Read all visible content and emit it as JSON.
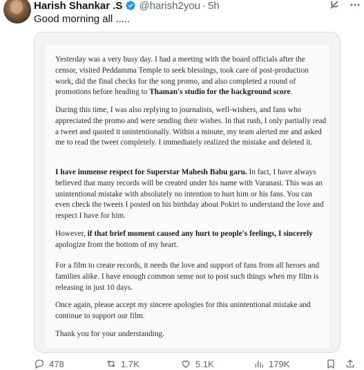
{
  "tweet": {
    "author_name": "Harish Shankar .S",
    "handle": "@harish2you",
    "separator": "·",
    "time": "5h",
    "text": "Good morning all .....",
    "verified": true
  },
  "note": {
    "p1": {
      "a": "Yesterday was a very busy day. I had a meeting with the board officials after the censor, visited Peddamma Temple to seek blessings, took care of post-production work, did the final checks for the song promo, and also completed a round of promotions before heading to ",
      "b": "Thaman's studio for the background score",
      "c": "."
    },
    "p2": "During this time, I was also replying to journalists, well-wishers, and fans who appreciated the promo and were sending their wishes. In that rush, I only partially read a tweet and quoted it unintentionally. Within a minute, my team alerted me and asked me to read the tweet completely. I immediately realized the mistake and deleted it.",
    "p3": {
      "a": "I have immense respect for Superstar Mahesh Babu garu.",
      "b": " In fact, I have always believed that many records will be created under his name with Varanasi. This was an unintentional mistake with absolutely no intention to hurt him or his fans. You can even check the tweets I posted on his birthday about Pokiri to understand the love and respect I have for him."
    },
    "p4": {
      "a": "However, ",
      "b": "if that brief moment caused any hurt to people's feelings, I sincerely",
      "c": " apologize from the bottom of my heart."
    },
    "p5": "For a film to create records, it needs the love and support of fans from all heroes and families alike. I have enough common sense not to post such things when my film is releasing in just 10 days.",
    "p6": "Once again, please accept my sincere apologies for this unintentional mistake and continue to support our film.",
    "p7": "Thank you for your understanding."
  },
  "actions": {
    "replies": "478",
    "reposts": "1.7K",
    "likes": "5.1K",
    "views": "179K"
  },
  "icons": [
    "verified-badge-icon",
    "grok-icon",
    "more-icon",
    "reply-icon",
    "repost-icon",
    "like-icon",
    "views-icon",
    "bookmark-icon",
    "share-icon"
  ],
  "colors": {
    "verified": "#1d9bf0",
    "muted": "#536471",
    "text": "#0f1419"
  }
}
